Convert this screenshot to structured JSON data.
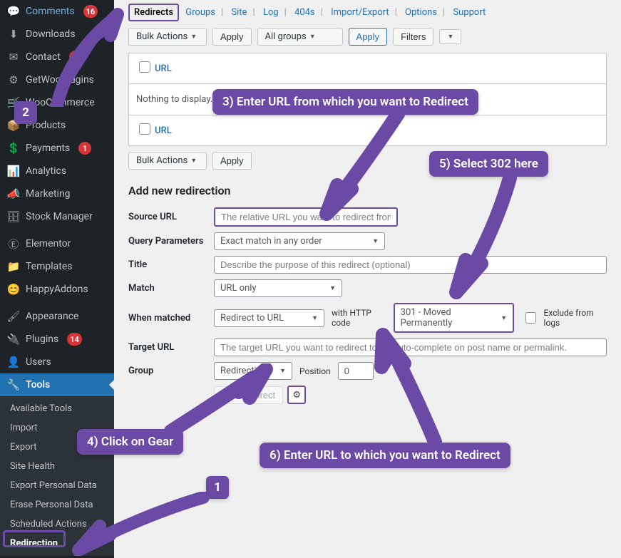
{
  "sidebar": {
    "items": [
      {
        "icon": "💬",
        "label": "Comments",
        "badge": "16"
      },
      {
        "icon": "⬇",
        "label": "Downloads"
      },
      {
        "icon": "✉",
        "label": "Contact",
        "badge": "1"
      },
      {
        "icon": "⚙",
        "label": "GetWooPlugins"
      },
      {
        "icon": "🛒",
        "label": "WooCommerce"
      },
      {
        "icon": "📦",
        "label": "Products"
      },
      {
        "icon": "💲",
        "label": "Payments",
        "badge": "1"
      },
      {
        "icon": "📊",
        "label": "Analytics"
      },
      {
        "icon": "📣",
        "label": "Marketing"
      },
      {
        "icon": "🗄",
        "label": "Stock Manager"
      }
    ],
    "group2": [
      {
        "icon": "Ⓔ",
        "label": "Elementor"
      },
      {
        "icon": "📁",
        "label": "Templates"
      },
      {
        "icon": "😊",
        "label": "HappyAddons"
      }
    ],
    "group3": [
      {
        "icon": "🖌",
        "label": "Appearance"
      },
      {
        "icon": "🔌",
        "label": "Plugins",
        "badge": "14"
      },
      {
        "icon": "👤",
        "label": "Users"
      },
      {
        "icon": "🔧",
        "label": "Tools",
        "current": true
      }
    ],
    "submenu": [
      "Available Tools",
      "Import",
      "Export",
      "Site Health",
      "Export Personal Data",
      "Erase Personal Data",
      "Scheduled Actions",
      "Redirection"
    ],
    "active_sub": "Redirection"
  },
  "tabs": {
    "active": "Redirects",
    "items": [
      "Redirects",
      "Groups",
      "Site",
      "Log",
      "404s",
      "Import/Export",
      "Options",
      "Support"
    ]
  },
  "toolbar": {
    "bulk": "Bulk Actions",
    "apply": "Apply",
    "groups_sel": "All groups",
    "apply2": "Apply",
    "filters": "Filters"
  },
  "table": {
    "url": "URL",
    "empty": "Nothing to display."
  },
  "form": {
    "title": "Add new redirection",
    "rows": {
      "source": {
        "label": "Source URL",
        "placeholder": "The relative URL you want to redirect from"
      },
      "query": {
        "label": "Query Parameters",
        "value": "Exact match in any order"
      },
      "titleRow": {
        "label": "Title",
        "placeholder": "Describe the purpose of this redirect (optional)"
      },
      "match": {
        "label": "Match",
        "value": "URL only"
      },
      "when": {
        "label": "When matched",
        "value": "Redirect to URL",
        "http_label": "with HTTP code",
        "http_value": "301 - Moved Permanently",
        "exclude": "Exclude from logs"
      },
      "target": {
        "label": "Target URL",
        "placeholder": "The target URL you want to redirect to, or auto-complete on post name or permalink."
      },
      "group": {
        "label": "Group",
        "value": "Redirections",
        "pos_label": "Position",
        "pos_value": "0"
      },
      "submit": "Add Redirect"
    }
  },
  "annotations": {
    "c1": "1",
    "c2": "2",
    "c3": "3) Enter URL from which you want to Redirect",
    "c4": "4) Click on Gear",
    "c5": "5) Select 302 here",
    "c6": "6) Enter URL to which you want to Redirect"
  }
}
